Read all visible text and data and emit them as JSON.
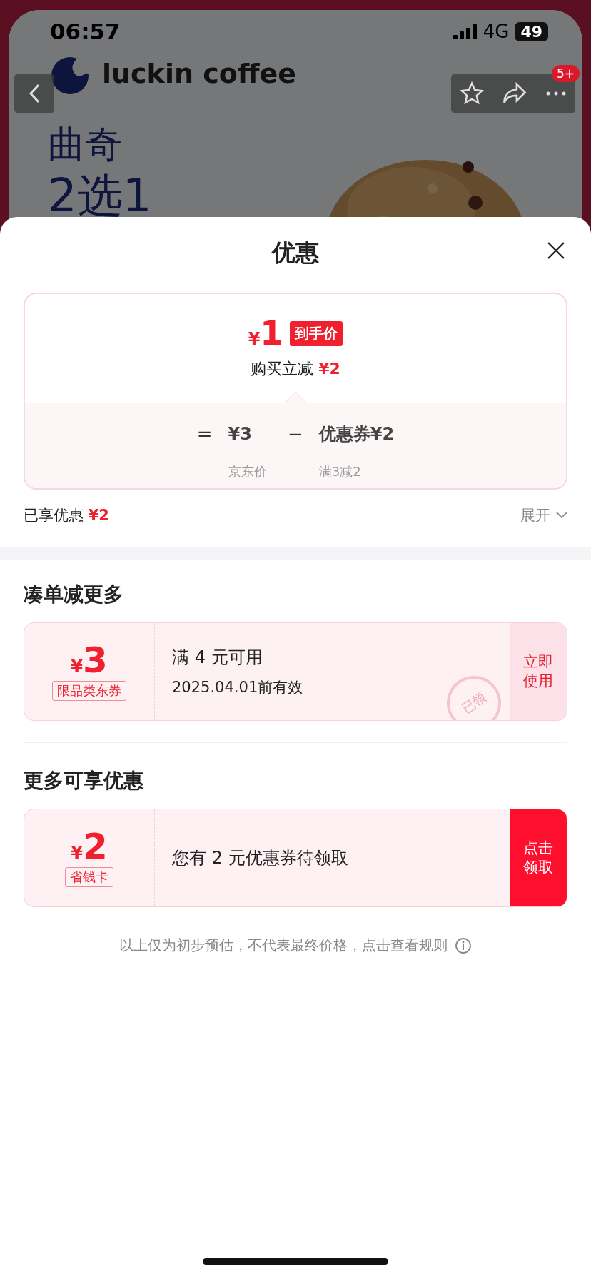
{
  "status_bar": {
    "time": "06:57",
    "network": "4G",
    "battery": "49"
  },
  "banner": {
    "brand": "luckin coffee",
    "headline": [
      "曲奇",
      "2选1"
    ],
    "badge": "5+"
  },
  "sheet": {
    "title": "优惠",
    "price_card": {
      "currency": "¥",
      "final_price": "1",
      "price_tag": "到手价",
      "discount_label": "购买立减",
      "discount_value": "¥2",
      "equals": "=",
      "base_price": "¥3",
      "base_label": "京东价",
      "minus": "−",
      "coupon_value": "优惠券¥2",
      "coupon_rule": "满3减2"
    },
    "saved": {
      "label": "已享优惠",
      "value": "¥2",
      "toggle": "展开",
      "expanded": false
    },
    "sections": [
      {
        "title": "凑单减更多",
        "coupons": [
          {
            "kind": "use",
            "currency": "¥",
            "amount": "3",
            "tag": "限品类东券",
            "lines": [
              "满 4 元可用",
              "2025.04.01前有效"
            ],
            "action": "立即使用",
            "stamp": "已领"
          }
        ]
      },
      {
        "title": "更多可享优惠",
        "coupons": [
          {
            "kind": "claim",
            "currency": "¥",
            "amount": "2",
            "tag": "省钱卡",
            "lines": [
              "您有 2 元优惠券待领取"
            ],
            "action": "点击领取"
          }
        ]
      }
    ],
    "footer": "以上仅为初步预估，不代表最终价格，点击查看规则"
  }
}
